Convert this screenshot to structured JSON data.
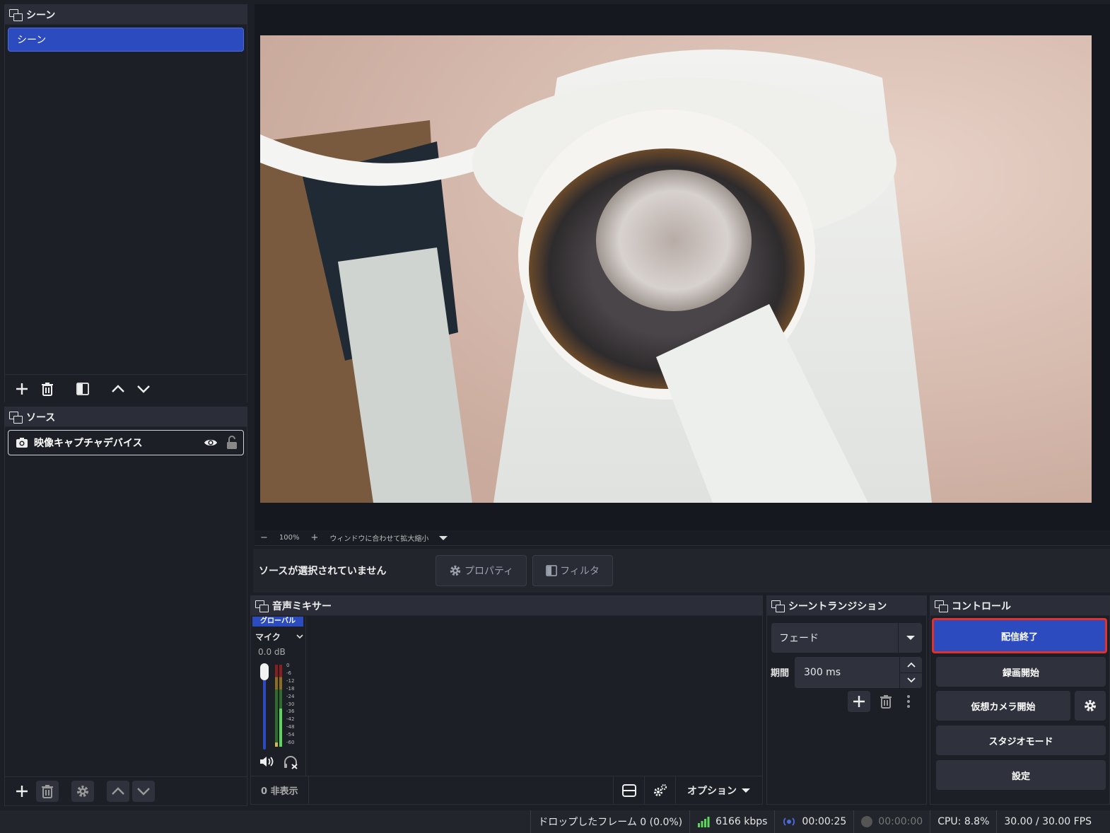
{
  "scenes": {
    "title": "シーン",
    "items": [
      "シーン"
    ]
  },
  "sources": {
    "title": "ソース",
    "items": [
      {
        "label": "映像キャプチャデバイス"
      }
    ]
  },
  "zoom": {
    "minus": "−",
    "level": "100%",
    "plus": "+",
    "fit_label": "ウィンドウに合わせて拡大縮小"
  },
  "properties_bar": {
    "no_source": "ソースが選択されていません",
    "properties": "プロパティ",
    "filters": "フィルタ"
  },
  "mixer": {
    "title": "音声ミキサー",
    "global_badge": "グローバル",
    "channel": "マイク",
    "db": "0.0 dB",
    "scale": [
      "0",
      "-6",
      "-12",
      "-18",
      "-24",
      "-30",
      "-36",
      "-42",
      "-48",
      "-54",
      "-60"
    ],
    "hidden_count": "0 非表示",
    "options": "オプション"
  },
  "transition": {
    "title": "シーントランジション",
    "selected": "フェード",
    "duration_label": "期間",
    "duration_value": "300 ms"
  },
  "controls": {
    "title": "コントロール",
    "stop_stream": "配信終了",
    "start_record": "録画開始",
    "virtual_cam": "仮想カメラ開始",
    "studio_mode": "スタジオモード",
    "settings": "設定"
  },
  "status": {
    "dropped": "ドロップしたフレーム 0 (0.0%)",
    "bitrate": "6166 kbps",
    "stream_time": "00:00:25",
    "record_time": "00:00:00",
    "cpu": "CPU: 8.8%",
    "fps": "30.00 / 30.00 FPS"
  },
  "colors": {
    "accent": "#2b4bbf",
    "highlight_border": "#e0322b",
    "bg": "#1d1f26",
    "meter_green": "#5cd65c"
  }
}
